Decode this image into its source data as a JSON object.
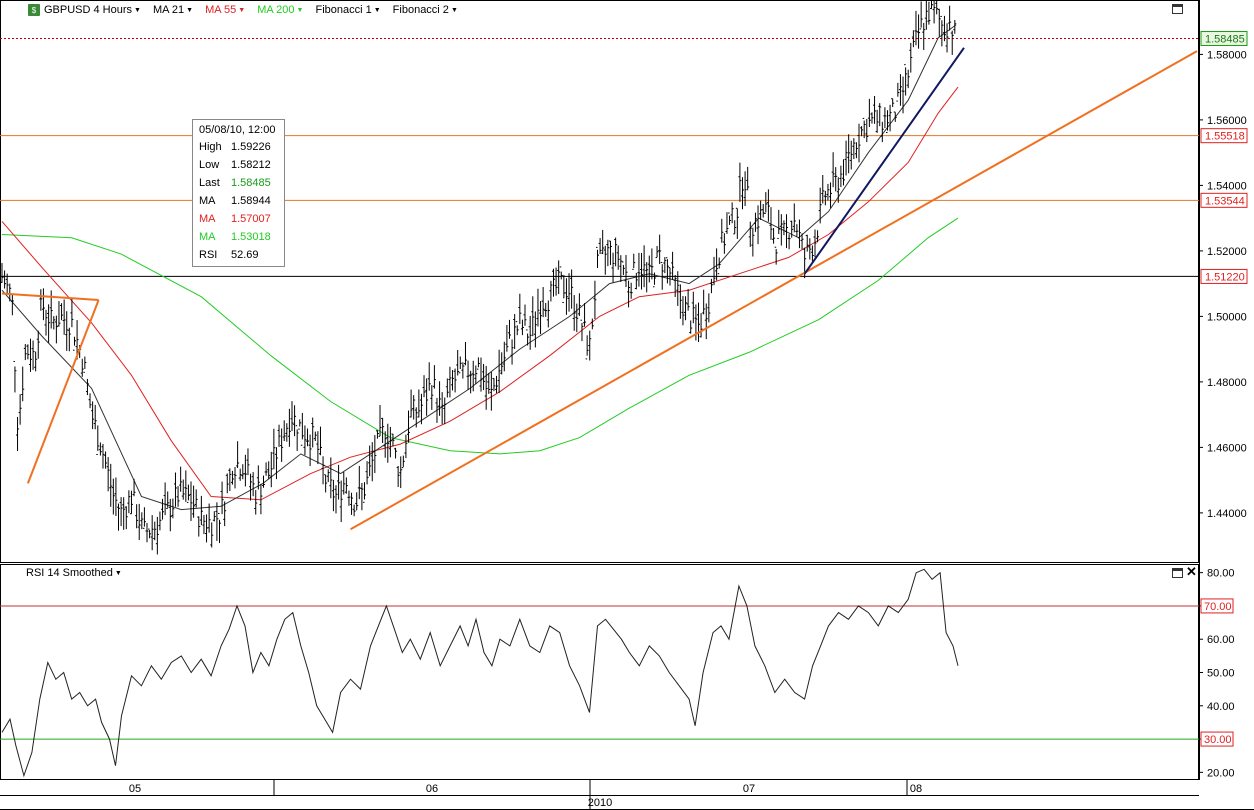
{
  "toolbar": {
    "icon": "chart-app-icon",
    "symbol": "GBPUSD 4 Hours",
    "ma21": "MA 21",
    "ma55": "MA 55",
    "ma200": "MA 200",
    "fib1": "Fibonacci 1",
    "fib2": "Fibonacci 2"
  },
  "info": {
    "date": "05/08/10, 12:00",
    "rows": [
      {
        "label": "High",
        "value": "1.59226"
      },
      {
        "label": "Low",
        "value": "1.58212"
      },
      {
        "label": "Last",
        "value": "1.58485"
      },
      {
        "label": "MA",
        "value": "1.58944"
      },
      {
        "label": "MA",
        "value": "1.57007"
      },
      {
        "label": "MA",
        "value": "1.53018"
      },
      {
        "label": "RSI",
        "value": "52.69"
      }
    ]
  },
  "rsi_panel": {
    "title": "RSI 14 Smoothed"
  },
  "colors": {
    "ma21": "#333333",
    "ma55": "#e02020",
    "ma200": "#22cc22",
    "trend_orange": "#f07020",
    "trend_navy": "#101860",
    "last_price": "#c00000",
    "fib": "#e07828"
  },
  "chart_data": [
    {
      "type": "ohlc",
      "title": "GBPUSD 4 Hours",
      "ylim": [
        1.425,
        1.596
      ],
      "yticks": [
        "1.58000",
        "1.56000",
        "1.54000",
        "1.52000",
        "1.50000",
        "1.48000",
        "1.46000",
        "1.44000"
      ],
      "xticks": [
        "05",
        "06",
        "07",
        "08"
      ],
      "year_label": "2010",
      "last_price": "1.58485",
      "horizontal_levels": [
        "1.55518",
        "1.53544",
        "1.51220"
      ],
      "price_path": [
        {
          "t": 0,
          "p": 1.512
        },
        {
          "t": 10,
          "p": 1.506
        },
        {
          "t": 16,
          "p": 1.466
        },
        {
          "t": 24,
          "p": 1.49
        },
        {
          "t": 33,
          "p": 1.488
        },
        {
          "t": 40,
          "p": 1.504
        },
        {
          "t": 50,
          "p": 1.498
        },
        {
          "t": 58,
          "p": 1.5
        },
        {
          "t": 70,
          "p": 1.498
        },
        {
          "t": 82,
          "p": 1.486
        },
        {
          "t": 90,
          "p": 1.47
        },
        {
          "t": 100,
          "p": 1.46
        },
        {
          "t": 112,
          "p": 1.445
        },
        {
          "t": 120,
          "p": 1.44
        },
        {
          "t": 130,
          "p": 1.445
        },
        {
          "t": 142,
          "p": 1.434
        },
        {
          "t": 155,
          "p": 1.436
        },
        {
          "t": 165,
          "p": 1.44
        },
        {
          "t": 178,
          "p": 1.446
        },
        {
          "t": 190,
          "p": 1.444
        },
        {
          "t": 200,
          "p": 1.438
        },
        {
          "t": 210,
          "p": 1.437
        },
        {
          "t": 220,
          "p": 1.44
        },
        {
          "t": 232,
          "p": 1.455
        },
        {
          "t": 242,
          "p": 1.455
        },
        {
          "t": 255,
          "p": 1.446
        },
        {
          "t": 268,
          "p": 1.452
        },
        {
          "t": 280,
          "p": 1.462
        },
        {
          "t": 290,
          "p": 1.47
        },
        {
          "t": 302,
          "p": 1.465
        },
        {
          "t": 315,
          "p": 1.462
        },
        {
          "t": 325,
          "p": 1.45
        },
        {
          "t": 335,
          "p": 1.445
        },
        {
          "t": 345,
          "p": 1.45
        },
        {
          "t": 355,
          "p": 1.443
        },
        {
          "t": 365,
          "p": 1.448
        },
        {
          "t": 375,
          "p": 1.459
        },
        {
          "t": 385,
          "p": 1.466
        },
        {
          "t": 393,
          "p": 1.46
        },
        {
          "t": 400,
          "p": 1.452
        },
        {
          "t": 410,
          "p": 1.47
        },
        {
          "t": 420,
          "p": 1.472
        },
        {
          "t": 432,
          "p": 1.48
        },
        {
          "t": 442,
          "p": 1.47
        },
        {
          "t": 452,
          "p": 1.48
        },
        {
          "t": 465,
          "p": 1.483
        },
        {
          "t": 478,
          "p": 1.485
        },
        {
          "t": 490,
          "p": 1.475
        },
        {
          "t": 500,
          "p": 1.484
        },
        {
          "t": 510,
          "p": 1.492
        },
        {
          "t": 520,
          "p": 1.498
        },
        {
          "t": 530,
          "p": 1.494
        },
        {
          "t": 540,
          "p": 1.504
        },
        {
          "t": 550,
          "p": 1.506
        },
        {
          "t": 560,
          "p": 1.51
        },
        {
          "t": 570,
          "p": 1.508
        },
        {
          "t": 580,
          "p": 1.5
        },
        {
          "t": 590,
          "p": 1.49
        },
        {
          "t": 598,
          "p": 1.515
        },
        {
          "t": 608,
          "p": 1.52
        },
        {
          "t": 620,
          "p": 1.518
        },
        {
          "t": 630,
          "p": 1.51
        },
        {
          "t": 640,
          "p": 1.516
        },
        {
          "t": 650,
          "p": 1.512
        },
        {
          "t": 660,
          "p": 1.518
        },
        {
          "t": 670,
          "p": 1.514
        },
        {
          "t": 680,
          "p": 1.506
        },
        {
          "t": 690,
          "p": 1.5
        },
        {
          "t": 700,
          "p": 1.497
        },
        {
          "t": 710,
          "p": 1.505
        },
        {
          "t": 718,
          "p": 1.518
        },
        {
          "t": 728,
          "p": 1.526
        },
        {
          "t": 738,
          "p": 1.532
        },
        {
          "t": 745,
          "p": 1.545
        },
        {
          "t": 752,
          "p": 1.528
        },
        {
          "t": 760,
          "p": 1.53
        },
        {
          "t": 768,
          "p": 1.533
        },
        {
          "t": 776,
          "p": 1.523
        },
        {
          "t": 786,
          "p": 1.525
        },
        {
          "t": 796,
          "p": 1.53
        },
        {
          "t": 806,
          "p": 1.518
        },
        {
          "t": 816,
          "p": 1.523
        },
        {
          "t": 826,
          "p": 1.537
        },
        {
          "t": 836,
          "p": 1.54
        },
        {
          "t": 846,
          "p": 1.545
        },
        {
          "t": 856,
          "p": 1.553
        },
        {
          "t": 866,
          "p": 1.558
        },
        {
          "t": 876,
          "p": 1.56
        },
        {
          "t": 886,
          "p": 1.56
        },
        {
          "t": 896,
          "p": 1.562
        },
        {
          "t": 903,
          "p": 1.567
        },
        {
          "t": 910,
          "p": 1.574
        },
        {
          "t": 916,
          "p": 1.582
        },
        {
          "t": 922,
          "p": 1.588
        },
        {
          "t": 930,
          "p": 1.593
        },
        {
          "t": 938,
          "p": 1.592
        },
        {
          "t": 946,
          "p": 1.588
        },
        {
          "t": 952,
          "p": 1.59
        },
        {
          "t": 958,
          "p": 1.585
        }
      ],
      "ma21": [
        [
          0,
          1.508
        ],
        [
          40,
          1.494
        ],
        [
          90,
          1.478
        ],
        [
          140,
          1.445
        ],
        [
          180,
          1.441
        ],
        [
          220,
          1.442
        ],
        [
          262,
          1.449
        ],
        [
          300,
          1.458
        ],
        [
          340,
          1.452
        ],
        [
          380,
          1.46
        ],
        [
          420,
          1.468
        ],
        [
          470,
          1.478
        ],
        [
          520,
          1.49
        ],
        [
          570,
          1.5
        ],
        [
          610,
          1.51
        ],
        [
          650,
          1.513
        ],
        [
          690,
          1.51
        ],
        [
          720,
          1.516
        ],
        [
          760,
          1.53
        ],
        [
          800,
          1.524
        ],
        [
          830,
          1.532
        ],
        [
          870,
          1.55
        ],
        [
          910,
          1.566
        ],
        [
          940,
          1.585
        ],
        [
          958,
          1.589
        ]
      ],
      "ma55": [
        [
          0,
          1.529
        ],
        [
          40,
          1.515
        ],
        [
          90,
          1.498
        ],
        [
          130,
          1.482
        ],
        [
          170,
          1.462
        ],
        [
          210,
          1.445
        ],
        [
          260,
          1.444
        ],
        [
          310,
          1.452
        ],
        [
          350,
          1.457
        ],
        [
          400,
          1.461
        ],
        [
          450,
          1.468
        ],
        [
          500,
          1.477
        ],
        [
          550,
          1.488
        ],
        [
          600,
          1.5
        ],
        [
          640,
          1.506
        ],
        [
          690,
          1.508
        ],
        [
          740,
          1.513
        ],
        [
          790,
          1.518
        ],
        [
          830,
          1.525
        ],
        [
          870,
          1.535
        ],
        [
          910,
          1.547
        ],
        [
          940,
          1.562
        ],
        [
          960,
          1.57
        ]
      ],
      "ma200": [
        [
          0,
          1.525
        ],
        [
          70,
          1.524
        ],
        [
          120,
          1.519
        ],
        [
          200,
          1.506
        ],
        [
          270,
          1.488
        ],
        [
          330,
          1.474
        ],
        [
          390,
          1.463
        ],
        [
          450,
          1.459
        ],
        [
          500,
          1.458
        ],
        [
          540,
          1.459
        ],
        [
          580,
          1.463
        ],
        [
          630,
          1.472
        ],
        [
          690,
          1.482
        ],
        [
          750,
          1.489
        ],
        [
          820,
          1.499
        ],
        [
          880,
          1.511
        ],
        [
          930,
          1.524
        ],
        [
          960,
          1.53
        ]
      ],
      "trendlines": [
        {
          "name": "orange-upper",
          "from": [
            350,
            1.435
          ],
          "to": [
            1200,
            1.581
          ]
        },
        {
          "name": "navy-short",
          "from": [
            806,
            1.513
          ],
          "to": [
            966,
            1.582
          ]
        },
        {
          "name": "triangle-a",
          "from": [
            0,
            1.507
          ],
          "to": [
            97,
            1.505
          ]
        },
        {
          "name": "triangle-b",
          "from": [
            97,
            1.505
          ],
          "to": [
            26,
            1.449
          ]
        }
      ]
    },
    {
      "type": "line",
      "title": "RSI 14 Smoothed",
      "ylim": [
        18,
        82
      ],
      "yticks": [
        "80.00",
        "70.00",
        "60.00",
        "50.00",
        "40.00",
        "30.00",
        "20.00"
      ],
      "levels": [
        "70.00",
        "30.00"
      ],
      "values": [
        [
          0,
          32
        ],
        [
          8,
          36
        ],
        [
          14,
          28
        ],
        [
          22,
          19
        ],
        [
          30,
          26
        ],
        [
          38,
          42
        ],
        [
          46,
          53
        ],
        [
          54,
          48
        ],
        [
          62,
          50
        ],
        [
          70,
          42
        ],
        [
          78,
          44
        ],
        [
          86,
          40
        ],
        [
          94,
          42
        ],
        [
          100,
          35
        ],
        [
          108,
          30
        ],
        [
          114,
          22
        ],
        [
          120,
          37
        ],
        [
          130,
          49
        ],
        [
          140,
          46
        ],
        [
          150,
          52
        ],
        [
          160,
          48
        ],
        [
          170,
          53
        ],
        [
          180,
          55
        ],
        [
          190,
          50
        ],
        [
          200,
          54
        ],
        [
          210,
          49
        ],
        [
          220,
          58
        ],
        [
          228,
          63
        ],
        [
          236,
          70
        ],
        [
          244,
          64
        ],
        [
          252,
          50
        ],
        [
          260,
          56
        ],
        [
          268,
          52
        ],
        [
          276,
          60
        ],
        [
          284,
          66
        ],
        [
          292,
          68
        ],
        [
          300,
          58
        ],
        [
          308,
          50
        ],
        [
          316,
          40
        ],
        [
          324,
          36
        ],
        [
          332,
          32
        ],
        [
          340,
          44
        ],
        [
          350,
          48
        ],
        [
          360,
          45
        ],
        [
          370,
          58
        ],
        [
          378,
          64
        ],
        [
          386,
          70
        ],
        [
          394,
          63
        ],
        [
          402,
          56
        ],
        [
          410,
          60
        ],
        [
          420,
          54
        ],
        [
          430,
          62
        ],
        [
          440,
          52
        ],
        [
          450,
          58
        ],
        [
          460,
          64
        ],
        [
          468,
          58
        ],
        [
          476,
          66
        ],
        [
          484,
          56
        ],
        [
          492,
          52
        ],
        [
          500,
          60
        ],
        [
          510,
          58
        ],
        [
          520,
          66
        ],
        [
          530,
          58
        ],
        [
          540,
          56
        ],
        [
          550,
          64
        ],
        [
          560,
          62
        ],
        [
          570,
          52
        ],
        [
          580,
          46
        ],
        [
          590,
          38
        ],
        [
          598,
          64
        ],
        [
          606,
          66
        ],
        [
          614,
          63
        ],
        [
          622,
          60
        ],
        [
          630,
          56
        ],
        [
          640,
          52
        ],
        [
          650,
          58
        ],
        [
          660,
          55
        ],
        [
          670,
          50
        ],
        [
          680,
          46
        ],
        [
          690,
          42
        ],
        [
          696,
          34
        ],
        [
          704,
          50
        ],
        [
          714,
          62
        ],
        [
          722,
          64
        ],
        [
          730,
          60
        ],
        [
          740,
          76
        ],
        [
          748,
          70
        ],
        [
          756,
          58
        ],
        [
          766,
          52
        ],
        [
          776,
          44
        ],
        [
          786,
          48
        ],
        [
          796,
          44
        ],
        [
          806,
          42
        ],
        [
          814,
          52
        ],
        [
          822,
          58
        ],
        [
          830,
          64
        ],
        [
          840,
          68
        ],
        [
          850,
          66
        ],
        [
          860,
          70
        ],
        [
          870,
          68
        ],
        [
          880,
          64
        ],
        [
          890,
          70
        ],
        [
          900,
          68
        ],
        [
          910,
          72
        ],
        [
          918,
          80
        ],
        [
          926,
          81
        ],
        [
          934,
          78
        ],
        [
          942,
          80
        ],
        [
          948,
          62
        ],
        [
          955,
          58
        ],
        [
          960,
          52
        ]
      ]
    }
  ]
}
